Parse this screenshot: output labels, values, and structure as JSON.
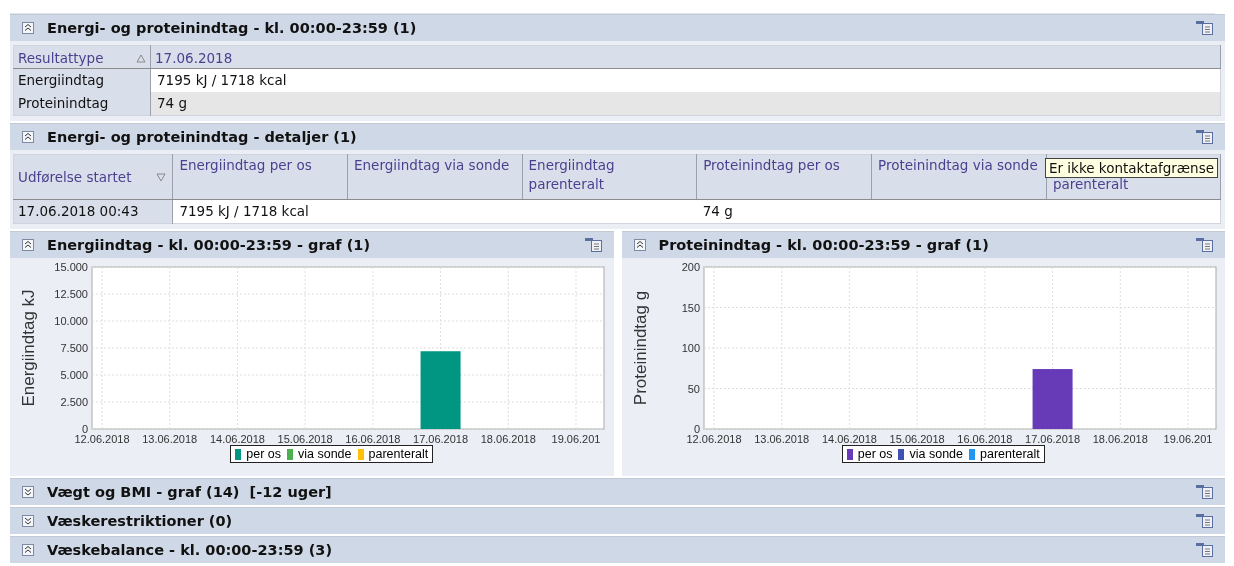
{
  "panels": [
    {
      "kind": "table",
      "title": "Energi- og proteinindtag - kl. 00:00-23:59 (1)",
      "expanded": true,
      "table": {
        "columns": [
          {
            "label": "Resultattype",
            "sorted": true,
            "descending": false
          },
          {
            "label": "17.06.2018"
          }
        ],
        "rows": [
          [
            "Energiindtag",
            "7195 kJ / 1718 kcal"
          ],
          [
            "Proteinindtag",
            "74 g"
          ]
        ]
      }
    },
    {
      "kind": "details",
      "title": "Energi- og proteinindtag - detaljer (1)",
      "expanded": true,
      "table": {
        "columns": [
          {
            "label": "Udførelse startet",
            "sorted": true,
            "descending": true
          },
          {
            "label": "Energiindtag per os"
          },
          {
            "label": "Energiindtag via sonde"
          },
          {
            "label": "Energiindtag parenteralt"
          },
          {
            "label": "Proteinindtag per os"
          },
          {
            "label": "Proteinindtag via sonde"
          },
          {
            "label": "parenteralt"
          }
        ],
        "rows": [
          [
            "17.06.2018 00:43",
            "7195 kJ / 1718 kcal",
            null,
            null,
            "74 g",
            null,
            null
          ]
        ]
      },
      "tooltip": {
        "text": "Er ikke kontaktafgrænse"
      }
    },
    {
      "kind": "charts",
      "charts": [
        {
          "title": "Energiindtag - kl. 00:00-23:59 - graf (1)",
          "expanded": true,
          "chart_data": {
            "type": "bar",
            "ylabel": "Energiindtag kJ",
            "categories": [
              "12.06.2018",
              "13.06.2018",
              "14.06.2018",
              "15.06.2018",
              "16.06.2018",
              "17.06.2018",
              "18.06.2018",
              "19.06.201"
            ],
            "ylim": [
              0,
              15000
            ],
            "grid": true,
            "yticks": [
              {
                "value": 0,
                "label": "0"
              },
              {
                "value": 2500,
                "label": "2.500"
              },
              {
                "value": 5000,
                "label": "5.000"
              },
              {
                "value": 7500,
                "label": "7.500"
              },
              {
                "value": 10000,
                "label": "10.000"
              },
              {
                "value": 12500,
                "label": "12.500"
              },
              {
                "value": 15000,
                "label": "15.000"
              }
            ],
            "series": [
              {
                "name": "per os",
                "color": "#009682",
                "values": [
                  null,
                  null,
                  null,
                  null,
                  null,
                  7200,
                  null,
                  null
                ]
              },
              {
                "name": "via sonde",
                "color": "#4caf50",
                "values": [
                  null,
                  null,
                  null,
                  null,
                  null,
                  null,
                  null,
                  null
                ]
              },
              {
                "name": "parenteralt",
                "color": "#ffc107",
                "values": [
                  null,
                  null,
                  null,
                  null,
                  null,
                  null,
                  null,
                  null
                ]
              }
            ]
          }
        },
        {
          "title": "Proteinindtag - kl. 00:00-23:59 - graf (1)",
          "expanded": true,
          "chart_data": {
            "type": "bar",
            "ylabel": "Proteinindtag g",
            "categories": [
              "12.06.2018",
              "13.06.2018",
              "14.06.2018",
              "15.06.2018",
              "16.06.2018",
              "17.06.2018",
              "18.06.2018",
              "19.06.201"
            ],
            "ylim": [
              0,
              200
            ],
            "grid": true,
            "yticks": [
              0,
              50,
              100,
              150,
              200
            ],
            "series": [
              {
                "name": "per os",
                "color": "#673ab7",
                "values": [
                  null,
                  null,
                  null,
                  null,
                  null,
                  74,
                  null,
                  null
                ]
              },
              {
                "name": "via sonde",
                "color": "#3f51b5",
                "values": [
                  null,
                  null,
                  null,
                  null,
                  null,
                  null,
                  null,
                  null
                ]
              },
              {
                "name": "parenteralt",
                "color": "#2196f3",
                "values": [
                  null,
                  null,
                  null,
                  null,
                  null,
                  null,
                  null,
                  null
                ]
              }
            ]
          }
        }
      ]
    },
    {
      "kind": "header",
      "title": "Vægt og BMI - graf (14)  [-12 uger]",
      "expanded": false
    },
    {
      "kind": "header",
      "title": "Væskerestriktioner (0)",
      "expanded": false
    },
    {
      "kind": "header",
      "title": "Væskebalance - kl. 00:00-23:59 (3)",
      "expanded": true
    }
  ]
}
